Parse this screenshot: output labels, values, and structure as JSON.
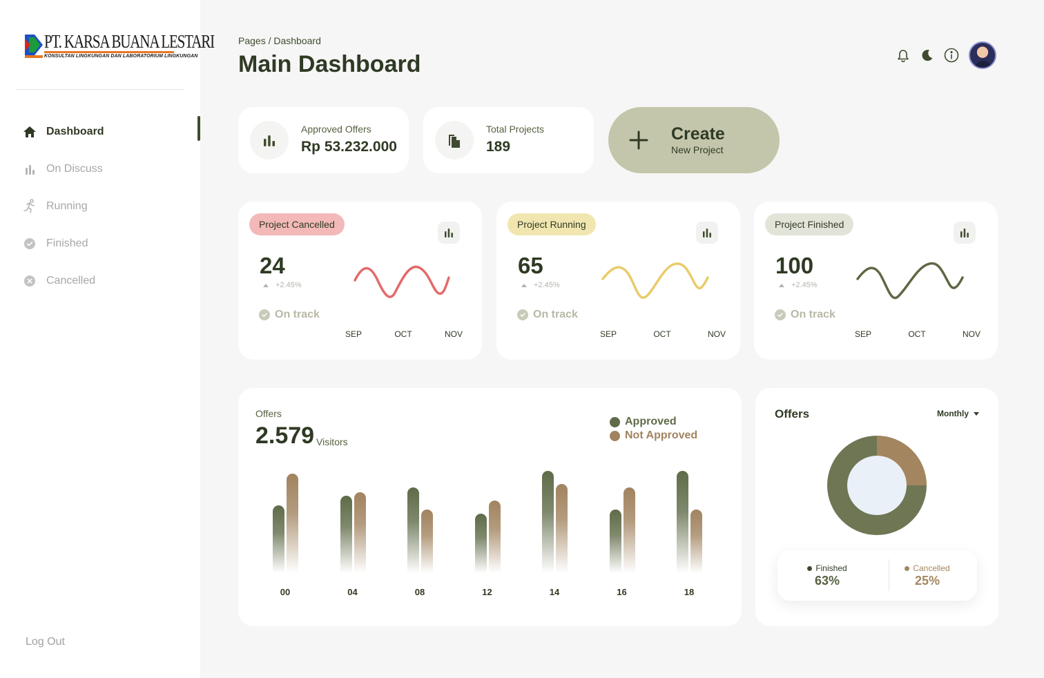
{
  "brand": {
    "name": "PT. KARSA BUANA LESTARI",
    "tagline": "KONSULTAN LINGKUNGAN DAN LABORATORIUM LINGKUNGAN"
  },
  "sidebar": {
    "items": [
      {
        "label": "Dashboard",
        "icon": "home-icon",
        "active": true
      },
      {
        "label": "On Discuss",
        "icon": "bar-chart-icon",
        "active": false
      },
      {
        "label": "Running",
        "icon": "running-icon",
        "active": false
      },
      {
        "label": "Finished",
        "icon": "check-circle-icon",
        "active": false
      },
      {
        "label": "Cancelled",
        "icon": "x-circle-icon",
        "active": false
      }
    ],
    "logout_label": "Log Out"
  },
  "header": {
    "breadcrumb": "Pages / Dashboard",
    "title": "Main Dashboard",
    "icons": [
      "bell-icon",
      "moon-icon",
      "info-icon",
      "avatar"
    ]
  },
  "stats": [
    {
      "label": "Approved Offers",
      "value": "Rp 53.232.000",
      "icon": "bar-chart-icon"
    },
    {
      "label": "Total Projects",
      "value": "189",
      "icon": "documents-icon"
    }
  ],
  "create": {
    "title": "Create",
    "subtitle": "New Project"
  },
  "projects": [
    {
      "badge": "Project Cancelled",
      "value": "24",
      "change": "+2.45%",
      "status": "On track",
      "months": [
        "SEP",
        "OCT",
        "NOV"
      ],
      "badge_color": "#f3b9b9",
      "line_color": "#e46a6a"
    },
    {
      "badge": "Project Running",
      "value": "65",
      "change": "+2.45%",
      "status": "On track",
      "months": [
        "SEP",
        "OCT",
        "NOV"
      ],
      "badge_color": "#f1e6b0",
      "line_color": "#e8cc6a"
    },
    {
      "badge": "Project Finished",
      "value": "100",
      "change": "+2.45%",
      "status": "On track",
      "months": [
        "SEP",
        "OCT",
        "NOV"
      ],
      "badge_color": "#e3e4d9",
      "line_color": "#5f6844"
    }
  ],
  "offers": {
    "label": "Offers",
    "value": "2.579",
    "unit": "Visitors",
    "legend": [
      {
        "name": "Approved",
        "color": "#5f6b48"
      },
      {
        "name": "Not Approved",
        "color": "#a1835f"
      }
    ]
  },
  "chart_data": {
    "type": "bar",
    "categories": [
      "00",
      "04",
      "08",
      "12",
      "14",
      "16",
      "18"
    ],
    "series": [
      {
        "name": "Approved",
        "values": [
          0.66,
          0.76,
          0.84,
          0.58,
          1.0,
          0.62,
          1.0
        ]
      },
      {
        "name": "Not Approved",
        "values": [
          0.97,
          0.79,
          0.62,
          0.71,
          0.87,
          0.84,
          0.62
        ]
      }
    ]
  },
  "donut": {
    "title": "Offers",
    "period": "Monthly",
    "segments": [
      {
        "name": "Finished",
        "percent": 63,
        "label": "63%",
        "color": "#6e7654"
      },
      {
        "name": "Cancelled",
        "percent": 25,
        "label": "25%",
        "color": "#a3865f"
      }
    ],
    "center_color": "#eaf0f8"
  }
}
